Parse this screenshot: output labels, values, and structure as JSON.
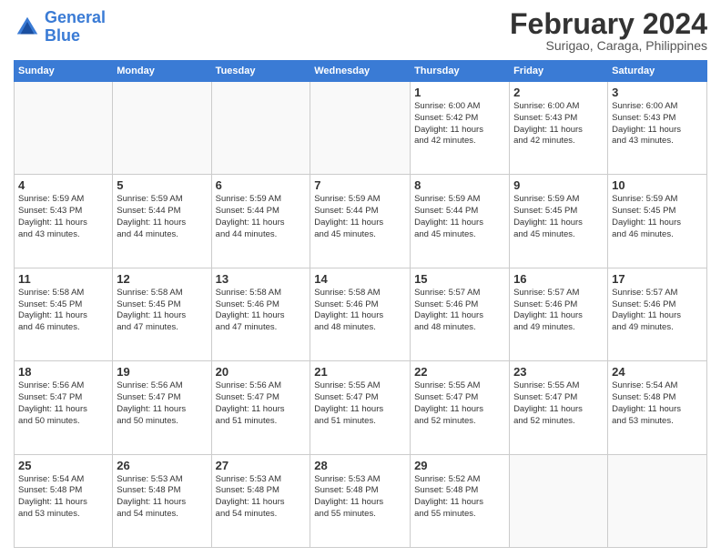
{
  "header": {
    "logo_line1": "General",
    "logo_line2": "Blue",
    "month": "February 2024",
    "location": "Surigao, Caraga, Philippines"
  },
  "days_of_week": [
    "Sunday",
    "Monday",
    "Tuesday",
    "Wednesday",
    "Thursday",
    "Friday",
    "Saturday"
  ],
  "weeks": [
    [
      {
        "day": "",
        "info": ""
      },
      {
        "day": "",
        "info": ""
      },
      {
        "day": "",
        "info": ""
      },
      {
        "day": "",
        "info": ""
      },
      {
        "day": "1",
        "info": "Sunrise: 6:00 AM\nSunset: 5:42 PM\nDaylight: 11 hours\nand 42 minutes."
      },
      {
        "day": "2",
        "info": "Sunrise: 6:00 AM\nSunset: 5:43 PM\nDaylight: 11 hours\nand 42 minutes."
      },
      {
        "day": "3",
        "info": "Sunrise: 6:00 AM\nSunset: 5:43 PM\nDaylight: 11 hours\nand 43 minutes."
      }
    ],
    [
      {
        "day": "4",
        "info": "Sunrise: 5:59 AM\nSunset: 5:43 PM\nDaylight: 11 hours\nand 43 minutes."
      },
      {
        "day": "5",
        "info": "Sunrise: 5:59 AM\nSunset: 5:44 PM\nDaylight: 11 hours\nand 44 minutes."
      },
      {
        "day": "6",
        "info": "Sunrise: 5:59 AM\nSunset: 5:44 PM\nDaylight: 11 hours\nand 44 minutes."
      },
      {
        "day": "7",
        "info": "Sunrise: 5:59 AM\nSunset: 5:44 PM\nDaylight: 11 hours\nand 45 minutes."
      },
      {
        "day": "8",
        "info": "Sunrise: 5:59 AM\nSunset: 5:44 PM\nDaylight: 11 hours\nand 45 minutes."
      },
      {
        "day": "9",
        "info": "Sunrise: 5:59 AM\nSunset: 5:45 PM\nDaylight: 11 hours\nand 45 minutes."
      },
      {
        "day": "10",
        "info": "Sunrise: 5:59 AM\nSunset: 5:45 PM\nDaylight: 11 hours\nand 46 minutes."
      }
    ],
    [
      {
        "day": "11",
        "info": "Sunrise: 5:58 AM\nSunset: 5:45 PM\nDaylight: 11 hours\nand 46 minutes."
      },
      {
        "day": "12",
        "info": "Sunrise: 5:58 AM\nSunset: 5:45 PM\nDaylight: 11 hours\nand 47 minutes."
      },
      {
        "day": "13",
        "info": "Sunrise: 5:58 AM\nSunset: 5:46 PM\nDaylight: 11 hours\nand 47 minutes."
      },
      {
        "day": "14",
        "info": "Sunrise: 5:58 AM\nSunset: 5:46 PM\nDaylight: 11 hours\nand 48 minutes."
      },
      {
        "day": "15",
        "info": "Sunrise: 5:57 AM\nSunset: 5:46 PM\nDaylight: 11 hours\nand 48 minutes."
      },
      {
        "day": "16",
        "info": "Sunrise: 5:57 AM\nSunset: 5:46 PM\nDaylight: 11 hours\nand 49 minutes."
      },
      {
        "day": "17",
        "info": "Sunrise: 5:57 AM\nSunset: 5:46 PM\nDaylight: 11 hours\nand 49 minutes."
      }
    ],
    [
      {
        "day": "18",
        "info": "Sunrise: 5:56 AM\nSunset: 5:47 PM\nDaylight: 11 hours\nand 50 minutes."
      },
      {
        "day": "19",
        "info": "Sunrise: 5:56 AM\nSunset: 5:47 PM\nDaylight: 11 hours\nand 50 minutes."
      },
      {
        "day": "20",
        "info": "Sunrise: 5:56 AM\nSunset: 5:47 PM\nDaylight: 11 hours\nand 51 minutes."
      },
      {
        "day": "21",
        "info": "Sunrise: 5:55 AM\nSunset: 5:47 PM\nDaylight: 11 hours\nand 51 minutes."
      },
      {
        "day": "22",
        "info": "Sunrise: 5:55 AM\nSunset: 5:47 PM\nDaylight: 11 hours\nand 52 minutes."
      },
      {
        "day": "23",
        "info": "Sunrise: 5:55 AM\nSunset: 5:47 PM\nDaylight: 11 hours\nand 52 minutes."
      },
      {
        "day": "24",
        "info": "Sunrise: 5:54 AM\nSunset: 5:48 PM\nDaylight: 11 hours\nand 53 minutes."
      }
    ],
    [
      {
        "day": "25",
        "info": "Sunrise: 5:54 AM\nSunset: 5:48 PM\nDaylight: 11 hours\nand 53 minutes."
      },
      {
        "day": "26",
        "info": "Sunrise: 5:53 AM\nSunset: 5:48 PM\nDaylight: 11 hours\nand 54 minutes."
      },
      {
        "day": "27",
        "info": "Sunrise: 5:53 AM\nSunset: 5:48 PM\nDaylight: 11 hours\nand 54 minutes."
      },
      {
        "day": "28",
        "info": "Sunrise: 5:53 AM\nSunset: 5:48 PM\nDaylight: 11 hours\nand 55 minutes."
      },
      {
        "day": "29",
        "info": "Sunrise: 5:52 AM\nSunset: 5:48 PM\nDaylight: 11 hours\nand 55 minutes."
      },
      {
        "day": "",
        "info": ""
      },
      {
        "day": "",
        "info": ""
      }
    ]
  ]
}
